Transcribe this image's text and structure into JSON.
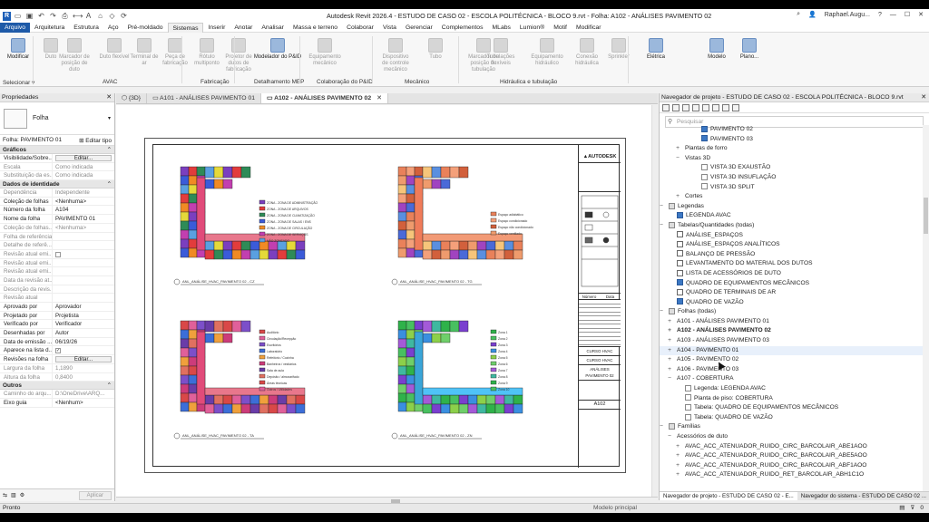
{
  "titlebar": {
    "app_icon": "R",
    "title": "Autodesk Revit 2026.4 - ESTUDO DE CASO 02 - ESCOLA POLITÉCNICA - BLOCO 9.rvt - Folha: A102 - ANÁLISES PAVIMENTO 02",
    "user": "Raphael.Augu...",
    "qat_icons": [
      "open-icon",
      "save-icon",
      "undo-icon",
      "redo-icon",
      "print-icon",
      "measure-icon",
      "text-icon",
      "3d-icon",
      "section-icon",
      "sync-icon"
    ]
  },
  "menu": {
    "tabs": [
      "Arquivo",
      "Arquitetura",
      "Estrutura",
      "Aço",
      "Pré-moldado",
      "Sistemas",
      "Inserir",
      "Anotar",
      "Analisar",
      "Massa e terreno",
      "Colaborar",
      "Vista",
      "Gerenciar",
      "Complementos",
      "MLabs",
      "Lumion®",
      "Motif",
      "Modificar"
    ],
    "active": "Sistemas"
  },
  "ribbon": {
    "buttons": [
      "Modificar",
      "Duto",
      "Marcador de posição de duto",
      "Duto flexível",
      "Terminal de ar",
      "Peça de fabricação",
      "Rótulo multiponto",
      "Projetor de dutos de fabricação",
      "Modelador do P&ID",
      "Equipamento mecânico",
      "Dispositivo de controle mecânico",
      "Tubo",
      "Marcador de posição de tubulação",
      "Tubulações flexíveis",
      "Equipamento hidráulico",
      "Conexão hidráulica",
      "Sprinkler",
      "Elétrica",
      "Modelo",
      "Plano..."
    ],
    "groups": [
      "Selecionar ▾",
      "AVAC",
      "Fabricação",
      "Detalhamento MEP",
      "Colaboração do P&ID",
      "Mecânico",
      "Hidráulica e tubulação"
    ]
  },
  "properties": {
    "title": "Propriedades",
    "type_name": "Folha",
    "instance_label": "Folha: PAVIMENTO 01",
    "edit_type": "Editar tipo",
    "apply": "Aplicar",
    "sections": [
      {
        "name": "Gráficos",
        "rows": [
          {
            "n": "Visibilidade/Sobre...",
            "v": "Editar...",
            "btn": true
          },
          {
            "n": "Escala",
            "v": "Como indicada",
            "gray": true
          },
          {
            "n": "Substituição da es...",
            "v": "Como indicada",
            "gray": true
          }
        ]
      },
      {
        "name": "Dados de identidade",
        "rows": [
          {
            "n": "Dependência",
            "v": "Independente",
            "gray": true
          },
          {
            "n": "Coleção de folhas",
            "v": "<Nenhuma>"
          },
          {
            "n": "Número da folha",
            "v": "A104"
          },
          {
            "n": "Nome da folha",
            "v": "PAVIMENTO 01"
          },
          {
            "n": "Coleção de folhas...",
            "v": "<Nenhuma>",
            "gray": true
          },
          {
            "n": "Folha de referência",
            "v": "",
            "gray": true
          },
          {
            "n": "Detalhe de referê...",
            "v": "",
            "gray": true
          },
          {
            "n": "Revisão atual emi...",
            "v": "",
            "gray": true,
            "chk": true
          },
          {
            "n": "Revisão atual emi...",
            "v": "",
            "gray": true
          },
          {
            "n": "Revisão atual emi...",
            "v": "",
            "gray": true
          },
          {
            "n": "Data da revisão at...",
            "v": "",
            "gray": true
          },
          {
            "n": "Descrição da revis...",
            "v": "",
            "gray": true
          },
          {
            "n": "Revisão atual",
            "v": "",
            "gray": true
          },
          {
            "n": "Aprovado por",
            "v": "Aprovador"
          },
          {
            "n": "Projetado por",
            "v": "Projetista"
          },
          {
            "n": "Verificado por",
            "v": "Verificador"
          },
          {
            "n": "Desenhadas por",
            "v": "Autor"
          },
          {
            "n": "Data de emissão ...",
            "v": "06/19/26"
          },
          {
            "n": "Aparece na lista d...",
            "v": "✓",
            "chk": true
          },
          {
            "n": "Revisões na folha",
            "v": "Editar...",
            "btn": true
          },
          {
            "n": "Largura da folha",
            "v": "1,1890",
            "gray": true
          },
          {
            "n": "Altura da folha",
            "v": "0,8400",
            "gray": true
          }
        ]
      },
      {
        "name": "Outros",
        "rows": [
          {
            "n": "Caminho do arqu...",
            "v": "D:\\OneDrive\\ARQ...",
            "gray": true
          },
          {
            "n": "Eixo guia",
            "v": "<Nenhum>"
          }
        ]
      }
    ]
  },
  "view_tabs": [
    {
      "label": "{3D}",
      "active": false
    },
    {
      "label": "A101 - ANÁLISES PAVIMENTO 01",
      "active": false
    },
    {
      "label": "A102 - ANÁLISES PAVIMENTO 02",
      "active": true
    }
  ],
  "sheet": {
    "titleblock": {
      "logo": "AUTODESK",
      "project1": "CURSO HVAC",
      "project2": "CURSO HVAC",
      "sheet_name": "ANÁLISES PAVIMENTO 02",
      "sheet_number": "A102",
      "col1": "Número",
      "col2": "Data"
    },
    "plans": [
      {
        "label": "ANL_ANÁLISE_HVAC_PAVIMENTO 02 - CZ",
        "legend": [
          "ZONA - ZONA DE ADMINISTRAÇÃO",
          "ZONA - ZONA DE ARQUIVOS",
          "ZONA - ZONA DE CLIMATIZAÇÃO",
          "ZONA - ZONA DE SALAS / ENS",
          "ZONA - ZONA DE CIRCULAÇÃO",
          "ZONA - ZONA DE SERVIÇOS",
          "NÃO ZONEADO"
        ]
      },
      {
        "label": "ANL_ANÁLISE_HVAC_PAVIMENTO 02 - TG",
        "legend": [
          "Espaço adiabático",
          "Espaço condicionado",
          "Espaço não condicionado",
          "Espaço ventilado"
        ]
      },
      {
        "label": "ANL_ANÁLISE_HVAC_PAVIMENTO 02 - TA",
        "legend": [
          "Auditório",
          "Circulação/Recepção",
          "Escritórios",
          "Laboratório",
          "Refeitório / Cozinha",
          "Banheiros / vestiários",
          "Sala de aula",
          "Depósito / almoxarifado",
          "Áreas técnicas",
          "Outros / Utilidades"
        ]
      },
      {
        "label": "ANL_ANÁLISE_HVAC_PAVIMENTO 02 - ZN",
        "legend": [
          "Zona 1",
          "Zona 2",
          "Zona 3",
          "Zona 4",
          "Zona 5",
          "Zona 6",
          "Zona 7",
          "Zona 8",
          "Zona 9",
          "Zona 10"
        ]
      }
    ]
  },
  "browser": {
    "title": "Navegador de projeto - ESTUDO DE CASO 02 - ESCOLA POLITÉCNICA - BLOCO 9.rvt",
    "search_placeholder": "Pesquisar",
    "tree": [
      {
        "t": "PAVIMENTO 02",
        "d": 4,
        "ic": "view"
      },
      {
        "t": "PAVIMENTO 03",
        "d": 4,
        "ic": "view"
      },
      {
        "t": "Plantas de forro",
        "d": 2,
        "tg": "+"
      },
      {
        "t": "Vistas 3D",
        "d": 2,
        "tg": "−"
      },
      {
        "t": "VISTA 3D EXAUSTÃO",
        "d": 4,
        "ic": "sheet"
      },
      {
        "t": "VISTA 3D INSUFLAÇÃO",
        "d": 4,
        "ic": "sheet"
      },
      {
        "t": "VISTA 3D SPLIT",
        "d": 4,
        "ic": "sheet"
      },
      {
        "t": "Cortes",
        "d": 2,
        "tg": "+"
      },
      {
        "t": "Legendas",
        "d": 0,
        "tg": "−",
        "ic": "fold"
      },
      {
        "t": "LEGENDA AVAC",
        "d": 1,
        "ic": "view"
      },
      {
        "t": "Tabelas/Quantidades (todas)",
        "d": 0,
        "tg": "−",
        "ic": "fold"
      },
      {
        "t": "ANÁLISE_ESPAÇOS",
        "d": 1,
        "ic": "tbl"
      },
      {
        "t": "ANÁLISE_ESPAÇOS ANALÍTICOS",
        "d": 1,
        "ic": "tbl"
      },
      {
        "t": "BALANÇO DE PRESSÃO",
        "d": 1,
        "ic": "tbl"
      },
      {
        "t": "LEVANTAMENTO DO MATERIAL DOS DUTOS",
        "d": 1,
        "ic": "tbl"
      },
      {
        "t": "LISTA DE ACESSÓRIOS DE DUTO",
        "d": 1,
        "ic": "tbl"
      },
      {
        "t": "QUADRO DE EQUIPAMENTOS MECÂNICOS",
        "d": 1,
        "ic": "view"
      },
      {
        "t": "QUADRO DE TERMINAIS DE AR",
        "d": 1,
        "ic": "tbl"
      },
      {
        "t": "QUADRO DE VAZÃO",
        "d": 1,
        "ic": "view"
      },
      {
        "t": "Folhas (todas)",
        "d": 0,
        "tg": "−",
        "ic": "fold"
      },
      {
        "t": "A101 - ANÁLISES PAVIMENTO 01",
        "d": 1,
        "tg": "+"
      },
      {
        "t": "A102 - ANÁLISES PAVIMENTO 02",
        "d": 1,
        "tg": "+",
        "bold": true
      },
      {
        "t": "A103 - ANÁLISES PAVIMENTO 03",
        "d": 1,
        "tg": "+"
      },
      {
        "t": "A104 - PAVIMENTO 01",
        "d": 1,
        "tg": "+",
        "sel": true
      },
      {
        "t": "A105 - PAVIMENTO 02",
        "d": 1,
        "tg": "+"
      },
      {
        "t": "A106 - PAVIMENTO 03",
        "d": 1,
        "tg": "+"
      },
      {
        "t": "A107 - COBERTURA",
        "d": 1,
        "tg": "−"
      },
      {
        "t": "Legenda: LEGENDA AVAC",
        "d": 2,
        "ic": "sheet"
      },
      {
        "t": "Planta de piso: COBERTURA",
        "d": 2,
        "ic": "sheet"
      },
      {
        "t": "Tabela: QUADRO DE EQUIPAMENTOS MECÂNICOS",
        "d": 2,
        "ic": "sheet"
      },
      {
        "t": "Tabela: QUADRO DE VAZÃO",
        "d": 2,
        "ic": "sheet"
      },
      {
        "t": "Famílias",
        "d": 0,
        "tg": "−",
        "ic": "fold"
      },
      {
        "t": "Acessórios de duto",
        "d": 1,
        "tg": "−"
      },
      {
        "t": "AVAC_ACC_ATENUADOR_RUIDO_CIRC_BARCOLAIR_ABE1AOO",
        "d": 2,
        "tg": "+"
      },
      {
        "t": "AVAC_ACC_ATENUADOR_RUIDO_CIRC_BARCOLAIR_ABE5AOO",
        "d": 2,
        "tg": "+"
      },
      {
        "t": "AVAC_ACC_ATENUADOR_RUIDO_CIRC_BARCOLAIR_ABF1AOO",
        "d": 2,
        "tg": "+"
      },
      {
        "t": "AVAC_ACC_ATENUADOR_RUIDO_RET_BARCOLAIR_ABH1C1O",
        "d": 2,
        "tg": "+"
      }
    ],
    "bottom_tabs": [
      "Navegador de projeto - ESTUDO DE CASO 02 - E...",
      "Navegador do sistema - ESTUDO DE CASO 02 ..."
    ]
  },
  "status": {
    "text": "Pronto",
    "model": "Modelo principal",
    "right": "0"
  }
}
